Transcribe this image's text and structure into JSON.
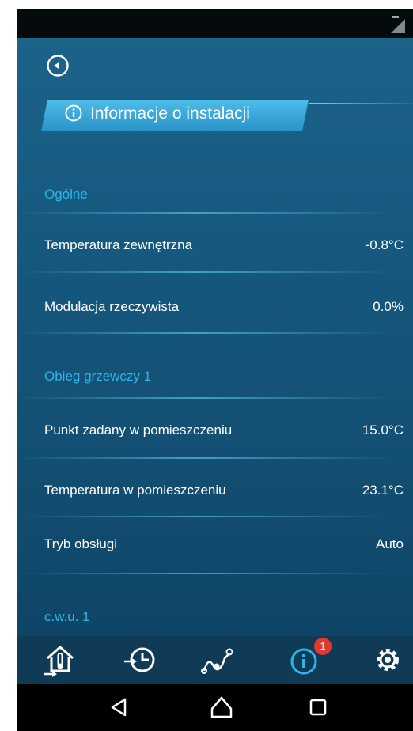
{
  "header": {
    "title": "Informacje o instalacji"
  },
  "sections": [
    {
      "title": "Ogólne",
      "rows": [
        {
          "label": "Temperatura zewnętrzna",
          "value": "-0.8°C"
        },
        {
          "label": "Modulacja rzeczywista",
          "value": "0.0%"
        }
      ]
    },
    {
      "title": "Obieg grzewczy 1",
      "rows": [
        {
          "label": "Punkt zadany w pomieszczeniu",
          "value": "15.0°C"
        },
        {
          "label": "Temperatura w pomieszczeniu",
          "value": "23.1°C"
        },
        {
          "label": "Tryb obsługi",
          "value": "Auto"
        }
      ]
    },
    {
      "title": "c.w.u. 1",
      "rows": []
    }
  ],
  "bottom_nav": {
    "items": [
      {
        "icon": "house-thermostat-icon"
      },
      {
        "icon": "clock-history-icon"
      },
      {
        "icon": "curve-graph-icon"
      },
      {
        "icon": "info-icon",
        "badge": "1",
        "active": true
      },
      {
        "icon": "gear-icon"
      }
    ]
  },
  "system_nav": {
    "icons": [
      "back-triangle-icon",
      "home-icon",
      "recents-square-icon"
    ]
  },
  "colors": {
    "accent": "#2fb4e8",
    "background": "#165a80",
    "badge": "#e23a33"
  }
}
